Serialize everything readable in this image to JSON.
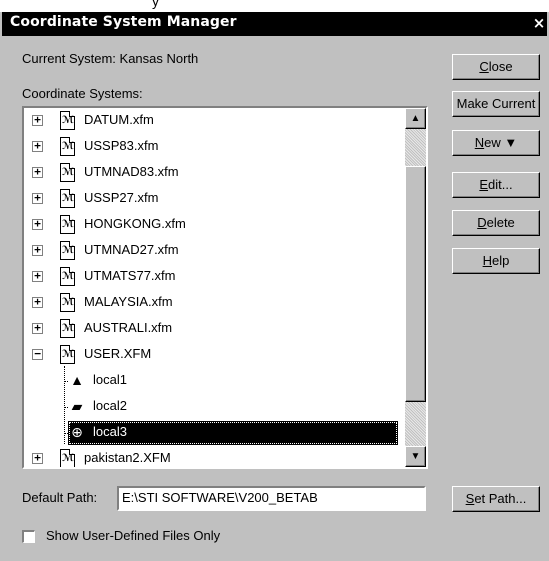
{
  "behind_window": {
    "title_fragment": "y"
  },
  "dialog": {
    "title": "Coordinate System Manager",
    "close_glyph": "×"
  },
  "current_system": {
    "label": "Current System: Kansas North"
  },
  "list": {
    "label": "Coordinate Systems:",
    "files": [
      {
        "name": "DATUM.xfm",
        "expander": "+"
      },
      {
        "name": "USSP83.xfm",
        "expander": "+"
      },
      {
        "name": "UTMNAD83.xfm",
        "expander": "+"
      },
      {
        "name": "USSP27.xfm",
        "expander": "+"
      },
      {
        "name": "HONGKONG.xfm",
        "expander": "+"
      },
      {
        "name": "UTMNAD27.xfm",
        "expander": "+"
      },
      {
        "name": "UTMATS77.xfm",
        "expander": "+"
      },
      {
        "name": "MALAYSIA.xfm",
        "expander": "+"
      },
      {
        "name": "AUSTRALI.xfm",
        "expander": "+"
      },
      {
        "name": "USER.XFM",
        "expander": "−"
      }
    ],
    "children": [
      {
        "name": "local1",
        "icon": "grid-pyramid-icon",
        "glyph": "▲"
      },
      {
        "name": "local2",
        "icon": "grid-plane-icon",
        "glyph": "▰"
      },
      {
        "name": "local3",
        "icon": "globe-icon",
        "glyph": "⊕",
        "selected": true
      }
    ],
    "partial_last": {
      "name": "pakistan2.XFM",
      "expander": "+"
    },
    "scroll_up_glyph": "▲",
    "scroll_down_glyph": "▼"
  },
  "buttons": {
    "close": {
      "pre": "",
      "ul": "C",
      "post": "lose"
    },
    "make_current": {
      "label": "Make Current"
    },
    "new": {
      "pre": "",
      "ul": "N",
      "post": "ew ▼"
    },
    "edit": {
      "pre": "",
      "ul": "E",
      "post": "dit..."
    },
    "delete": {
      "pre": "",
      "ul": "D",
      "post": "elete"
    },
    "help": {
      "pre": "",
      "ul": "H",
      "post": "elp"
    },
    "set_path": {
      "pre": "",
      "ul": "S",
      "post": "et Path..."
    }
  },
  "default_path": {
    "label": "Default Path:",
    "value": "E:\\STI SOFTWARE\\V200_BETAB"
  },
  "show_user_defined": {
    "label": "Show User-Defined Files Only",
    "checked": false
  }
}
